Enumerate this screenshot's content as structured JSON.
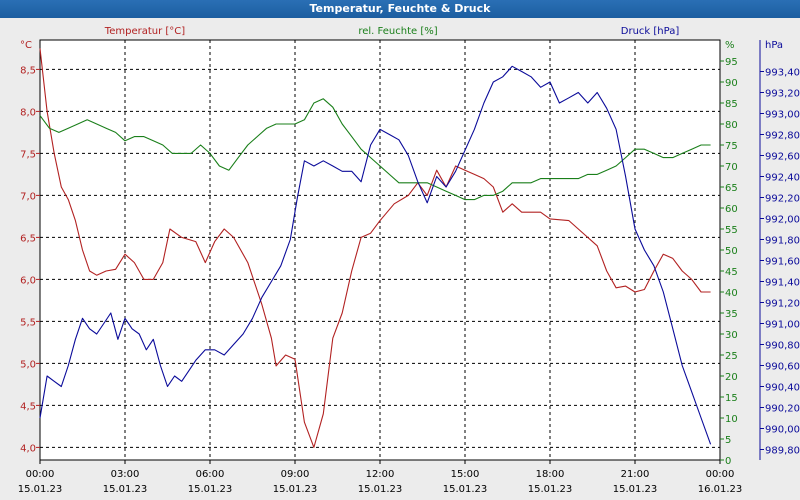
{
  "window": {
    "title": "Temperatur, Feuchte & Druck"
  },
  "chart_data": {
    "type": "line",
    "title": "Temperatur, Feuchte & Druck",
    "grid": true,
    "x": {
      "ticks": [
        {
          "time": "00:00",
          "date": "15.01.23"
        },
        {
          "time": "03:00",
          "date": "15.01.23"
        },
        {
          "time": "06:00",
          "date": "15.01.23"
        },
        {
          "time": "09:00",
          "date": "15.01.23"
        },
        {
          "time": "12:00",
          "date": "15.01.23"
        },
        {
          "time": "15:00",
          "date": "15.01.23"
        },
        {
          "time": "18:00",
          "date": "15.01.23"
        },
        {
          "time": "21:00",
          "date": "15.01.23"
        },
        {
          "time": "00:00",
          "date": "16.01.23"
        }
      ],
      "range": [
        "15.01.23 00:00",
        "16.01.23 00:00"
      ]
    },
    "axes": {
      "temperature": {
        "label": "Temperatur [°C]",
        "unit": "°C",
        "min": 3.85,
        "max": 8.85,
        "ticks": [
          "4,0",
          "4,5",
          "5,0",
          "5,5",
          "6,0",
          "6,5",
          "7,0",
          "7,5",
          "8,0",
          "8,5"
        ]
      },
      "humidity": {
        "label": "rel. Feuchte [%]",
        "unit": "%",
        "min": 0,
        "max": 100,
        "ticks": [
          "0",
          "5",
          "10",
          "15",
          "20",
          "25",
          "30",
          "35",
          "40",
          "45",
          "50",
          "55",
          "60",
          "65",
          "70",
          "75",
          "80",
          "85",
          "90",
          "95"
        ]
      },
      "pressure": {
        "label": "Druck [hPa]",
        "unit": "hPa",
        "min": 989.7,
        "max": 993.7,
        "ticks": [
          "989,80",
          "990,00",
          "990,20",
          "990,40",
          "990,60",
          "990,80",
          "991,00",
          "991,20",
          "991,40",
          "991,60",
          "991,80",
          "992,00",
          "992,20",
          "992,40",
          "992,60",
          "992,80",
          "993,00",
          "993,20",
          "993,40"
        ]
      }
    },
    "colors": {
      "temperature": "#b22222",
      "humidity": "#1a7f1a",
      "pressure": "#0b0b9a",
      "grid": "#000000",
      "titlebar": "#1f63a8"
    },
    "series": [
      {
        "name": "Temperatur [°C]",
        "axis": "temperature",
        "points": [
          [
            "15.01.23 00:00",
            8.75
          ],
          [
            "15.01.23 00:15",
            8.0
          ],
          [
            "15.01.23 00:30",
            7.5
          ],
          [
            "15.01.23 00:45",
            7.1
          ],
          [
            "15.01.23 01:00",
            6.95
          ],
          [
            "15.01.23 01:15",
            6.7
          ],
          [
            "15.01.23 01:30",
            6.35
          ],
          [
            "15.01.23 01:45",
            6.1
          ],
          [
            "15.01.23 02:00",
            6.05
          ],
          [
            "15.01.23 02:20",
            6.1
          ],
          [
            "15.01.23 02:40",
            6.12
          ],
          [
            "15.01.23 03:00",
            6.3
          ],
          [
            "15.01.23 03:20",
            6.2
          ],
          [
            "15.01.23 03:40",
            6.0
          ],
          [
            "15.01.23 04:00",
            6.0
          ],
          [
            "15.01.23 04:20",
            6.2
          ],
          [
            "15.01.23 04:35",
            6.6
          ],
          [
            "15.01.23 05:00",
            6.5
          ],
          [
            "15.01.23 05:30",
            6.45
          ],
          [
            "15.01.23 05:50",
            6.2
          ],
          [
            "15.01.23 06:10",
            6.45
          ],
          [
            "15.01.23 06:30",
            6.6
          ],
          [
            "15.01.23 06:50",
            6.5
          ],
          [
            "15.01.23 07:20",
            6.2
          ],
          [
            "15.01.23 07:50",
            5.7
          ],
          [
            "15.01.23 08:10",
            5.3
          ],
          [
            "15.01.23 08:20",
            4.97
          ],
          [
            "15.01.23 08:40",
            5.1
          ],
          [
            "15.01.23 09:00",
            5.05
          ],
          [
            "15.01.23 09:20",
            4.3
          ],
          [
            "15.01.23 09:40",
            4.0
          ],
          [
            "15.01.23 10:00",
            4.4
          ],
          [
            "15.01.23 10:20",
            5.3
          ],
          [
            "15.01.23 10:40",
            5.6
          ],
          [
            "15.01.23 11:00",
            6.1
          ],
          [
            "15.01.23 11:20",
            6.5
          ],
          [
            "15.01.23 11:40",
            6.55
          ],
          [
            "15.01.23 12:00",
            6.7
          ],
          [
            "15.01.23 12:30",
            6.9
          ],
          [
            "15.01.23 13:00",
            7.0
          ],
          [
            "15.01.23 13:20",
            7.15
          ],
          [
            "15.01.23 13:40",
            7.0
          ],
          [
            "15.01.23 14:00",
            7.3
          ],
          [
            "15.01.23 14:20",
            7.1
          ],
          [
            "15.01.23 14:40",
            7.35
          ],
          [
            "15.01.23 15:00",
            7.3
          ],
          [
            "15.01.23 15:20",
            7.25
          ],
          [
            "15.01.23 15:40",
            7.2
          ],
          [
            "15.01.23 16:00",
            7.1
          ],
          [
            "15.01.23 16:20",
            6.8
          ],
          [
            "15.01.23 16:40",
            6.9
          ],
          [
            "15.01.23 17:00",
            6.8
          ],
          [
            "15.01.23 17:40",
            6.8
          ],
          [
            "15.01.23 18:00",
            6.72
          ],
          [
            "15.01.23 18:40",
            6.7
          ],
          [
            "15.01.23 19:00",
            6.6
          ],
          [
            "15.01.23 19:40",
            6.4
          ],
          [
            "15.01.23 20:00",
            6.1
          ],
          [
            "15.01.23 20:20",
            5.9
          ],
          [
            "15.01.23 20:40",
            5.92
          ],
          [
            "15.01.23 21:00",
            5.85
          ],
          [
            "15.01.23 21:20",
            5.88
          ],
          [
            "15.01.23 21:40",
            6.1
          ],
          [
            "15.01.23 22:00",
            6.3
          ],
          [
            "15.01.23 22:20",
            6.25
          ],
          [
            "15.01.23 22:40",
            6.1
          ],
          [
            "15.01.23 23:00",
            6.0
          ],
          [
            "15.01.23 23:20",
            5.85
          ],
          [
            "15.01.23 23:40",
            5.85
          ]
        ]
      },
      {
        "name": "rel. Feuchte [%]",
        "axis": "humidity",
        "points": [
          [
            "15.01.23 00:00",
            82
          ],
          [
            "15.01.23 00:20",
            79
          ],
          [
            "15.01.23 00:40",
            78
          ],
          [
            "15.01.23 01:00",
            79
          ],
          [
            "15.01.23 01:20",
            80
          ],
          [
            "15.01.23 01:40",
            81
          ],
          [
            "15.01.23 02:00",
            80
          ],
          [
            "15.01.23 02:20",
            79
          ],
          [
            "15.01.23 02:40",
            78
          ],
          [
            "15.01.23 03:00",
            76
          ],
          [
            "15.01.23 03:20",
            77
          ],
          [
            "15.01.23 03:40",
            77
          ],
          [
            "15.01.23 04:00",
            76
          ],
          [
            "15.01.23 04:20",
            75
          ],
          [
            "15.01.23 04:40",
            73
          ],
          [
            "15.01.23 05:00",
            73
          ],
          [
            "15.01.23 05:20",
            73
          ],
          [
            "15.01.23 05:40",
            75
          ],
          [
            "15.01.23 06:00",
            73
          ],
          [
            "15.01.23 06:20",
            70
          ],
          [
            "15.01.23 06:40",
            69
          ],
          [
            "15.01.23 07:00",
            72
          ],
          [
            "15.01.23 07:20",
            75
          ],
          [
            "15.01.23 07:40",
            77
          ],
          [
            "15.01.23 08:00",
            79
          ],
          [
            "15.01.23 08:20",
            80
          ],
          [
            "15.01.23 08:40",
            80
          ],
          [
            "15.01.23 09:00",
            80
          ],
          [
            "15.01.23 09:20",
            81
          ],
          [
            "15.01.23 09:40",
            85
          ],
          [
            "15.01.23 10:00",
            86
          ],
          [
            "15.01.23 10:20",
            84
          ],
          [
            "15.01.23 10:40",
            80
          ],
          [
            "15.01.23 11:00",
            77
          ],
          [
            "15.01.23 11:20",
            74
          ],
          [
            "15.01.23 11:40",
            72
          ],
          [
            "15.01.23 12:00",
            70
          ],
          [
            "15.01.23 12:20",
            68
          ],
          [
            "15.01.23 12:40",
            66
          ],
          [
            "15.01.23 13:00",
            66
          ],
          [
            "15.01.23 13:20",
            66
          ],
          [
            "15.01.23 13:40",
            66
          ],
          [
            "15.01.23 14:00",
            65
          ],
          [
            "15.01.23 14:20",
            64
          ],
          [
            "15.01.23 14:40",
            63
          ],
          [
            "15.01.23 15:00",
            62
          ],
          [
            "15.01.23 15:20",
            62
          ],
          [
            "15.01.23 15:40",
            63
          ],
          [
            "15.01.23 16:00",
            63
          ],
          [
            "15.01.23 16:20",
            64
          ],
          [
            "15.01.23 16:40",
            66
          ],
          [
            "15.01.23 17:00",
            66
          ],
          [
            "15.01.23 17:20",
            66
          ],
          [
            "15.01.23 17:40",
            67
          ],
          [
            "15.01.23 18:00",
            67
          ],
          [
            "15.01.23 18:20",
            67
          ],
          [
            "15.01.23 18:40",
            67
          ],
          [
            "15.01.23 19:00",
            67
          ],
          [
            "15.01.23 19:20",
            68
          ],
          [
            "15.01.23 19:40",
            68
          ],
          [
            "15.01.23 20:00",
            69
          ],
          [
            "15.01.23 20:20",
            70
          ],
          [
            "15.01.23 20:40",
            72
          ],
          [
            "15.01.23 21:00",
            74
          ],
          [
            "15.01.23 21:20",
            74
          ],
          [
            "15.01.23 21:40",
            73
          ],
          [
            "15.01.23 22:00",
            72
          ],
          [
            "15.01.23 22:20",
            72
          ],
          [
            "15.01.23 22:40",
            73
          ],
          [
            "15.01.23 23:00",
            74
          ],
          [
            "15.01.23 23:20",
            75
          ],
          [
            "15.01.23 23:40",
            75
          ]
        ]
      },
      {
        "name": "Druck [hPa]",
        "axis": "pressure",
        "points": [
          [
            "15.01.23 00:00",
            990.1
          ],
          [
            "15.01.23 00:15",
            990.5
          ],
          [
            "15.01.23 00:30",
            990.45
          ],
          [
            "15.01.23 00:45",
            990.4
          ],
          [
            "15.01.23 01:00",
            990.6
          ],
          [
            "15.01.23 01:15",
            990.85
          ],
          [
            "15.01.23 01:30",
            991.05
          ],
          [
            "15.01.23 01:45",
            990.95
          ],
          [
            "15.01.23 02:00",
            990.9
          ],
          [
            "15.01.23 02:15",
            991.0
          ],
          [
            "15.01.23 02:30",
            991.1
          ],
          [
            "15.01.23 02:45",
            990.85
          ],
          [
            "15.01.23 03:00",
            991.05
          ],
          [
            "15.01.23 03:15",
            990.95
          ],
          [
            "15.01.23 03:30",
            990.9
          ],
          [
            "15.01.23 03:45",
            990.75
          ],
          [
            "15.01.23 04:00",
            990.85
          ],
          [
            "15.01.23 04:15",
            990.6
          ],
          [
            "15.01.23 04:30",
            990.4
          ],
          [
            "15.01.23 04:45",
            990.5
          ],
          [
            "15.01.23 05:00",
            990.45
          ],
          [
            "15.01.23 05:15",
            990.55
          ],
          [
            "15.01.23 05:30",
            990.65
          ],
          [
            "15.01.23 05:50",
            990.75
          ],
          [
            "15.01.23 06:10",
            990.75
          ],
          [
            "15.01.23 06:30",
            990.7
          ],
          [
            "15.01.23 06:50",
            990.8
          ],
          [
            "15.01.23 07:10",
            990.9
          ],
          [
            "15.01.23 07:30",
            991.05
          ],
          [
            "15.01.23 07:50",
            991.25
          ],
          [
            "15.01.23 08:10",
            991.4
          ],
          [
            "15.01.23 08:30",
            991.55
          ],
          [
            "15.01.23 08:50",
            991.8
          ],
          [
            "15.01.23 09:05",
            992.2
          ],
          [
            "15.01.23 09:20",
            992.55
          ],
          [
            "15.01.23 09:40",
            992.5
          ],
          [
            "15.01.23 10:00",
            992.55
          ],
          [
            "15.01.23 10:20",
            992.5
          ],
          [
            "15.01.23 10:40",
            992.45
          ],
          [
            "15.01.23 11:00",
            992.45
          ],
          [
            "15.01.23 11:20",
            992.35
          ],
          [
            "15.01.23 11:40",
            992.7
          ],
          [
            "15.01.23 12:00",
            992.85
          ],
          [
            "15.01.23 12:20",
            992.8
          ],
          [
            "15.01.23 12:40",
            992.75
          ],
          [
            "15.01.23 13:00",
            992.6
          ],
          [
            "15.01.23 13:20",
            992.35
          ],
          [
            "15.01.23 13:40",
            992.15
          ],
          [
            "15.01.23 14:00",
            992.4
          ],
          [
            "15.01.23 14:20",
            992.3
          ],
          [
            "15.01.23 14:40",
            992.45
          ],
          [
            "15.01.23 15:00",
            992.65
          ],
          [
            "15.01.23 15:20",
            992.85
          ],
          [
            "15.01.23 15:40",
            993.1
          ],
          [
            "15.01.23 16:00",
            993.3
          ],
          [
            "15.01.23 16:20",
            993.35
          ],
          [
            "15.01.23 16:40",
            993.45
          ],
          [
            "15.01.23 17:00",
            993.4
          ],
          [
            "15.01.23 17:20",
            993.35
          ],
          [
            "15.01.23 17:40",
            993.25
          ],
          [
            "15.01.23 18:00",
            993.3
          ],
          [
            "15.01.23 18:20",
            993.1
          ],
          [
            "15.01.23 18:40",
            993.15
          ],
          [
            "15.01.23 19:00",
            993.2
          ],
          [
            "15.01.23 19:20",
            993.1
          ],
          [
            "15.01.23 19:40",
            993.2
          ],
          [
            "15.01.23 20:00",
            993.05
          ],
          [
            "15.01.23 20:20",
            992.85
          ],
          [
            "15.01.23 20:40",
            992.4
          ],
          [
            "15.01.23 21:00",
            991.9
          ],
          [
            "15.01.23 21:20",
            991.7
          ],
          [
            "15.01.23 21:40",
            991.55
          ],
          [
            "15.01.23 22:00",
            991.3
          ],
          [
            "15.01.23 22:20",
            990.95
          ],
          [
            "15.01.23 22:40",
            990.6
          ],
          [
            "15.01.23 23:00",
            990.35
          ],
          [
            "15.01.23 23:20",
            990.1
          ],
          [
            "15.01.23 23:40",
            989.85
          ]
        ]
      }
    ]
  }
}
